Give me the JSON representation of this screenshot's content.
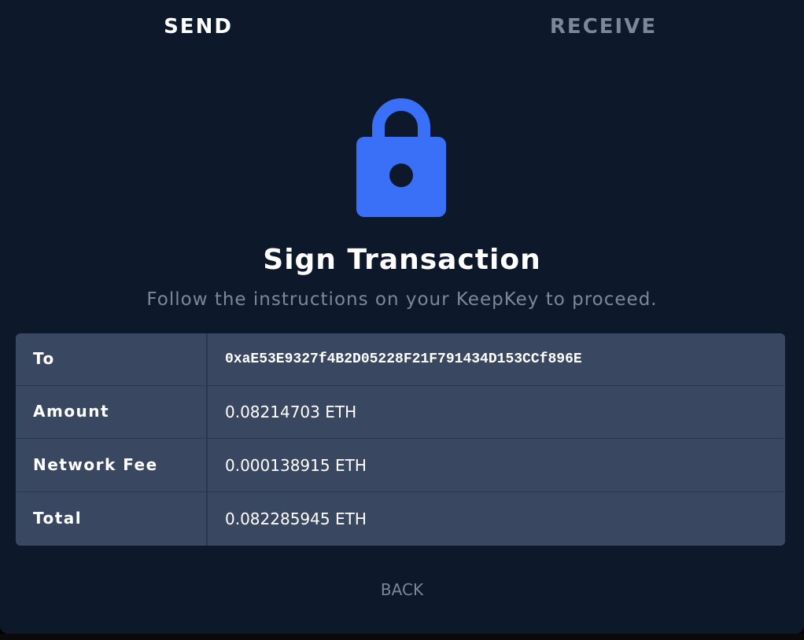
{
  "tabs": {
    "send": "SEND",
    "receive": "RECEIVE"
  },
  "icon": {
    "name": "lock-icon",
    "color": "#3a6ff8"
  },
  "header": {
    "title": "Sign Transaction",
    "subtitle": "Follow the instructions on your KeepKey to proceed."
  },
  "details": [
    {
      "label": "To",
      "value": "0xaE53E9327f4B2D05228F21F791434D153CCf896E"
    },
    {
      "label": "Amount",
      "value": "0.08214703 ETH"
    },
    {
      "label": "Network Fee",
      "value": "0.000138915 ETH"
    },
    {
      "label": "Total",
      "value": "0.082285945 ETH"
    }
  ],
  "actions": {
    "back": "BACK"
  },
  "colors": {
    "background": "#0e182b",
    "table": "#3a4760",
    "accent": "#3a6ff8",
    "muted": "#7d8799"
  }
}
